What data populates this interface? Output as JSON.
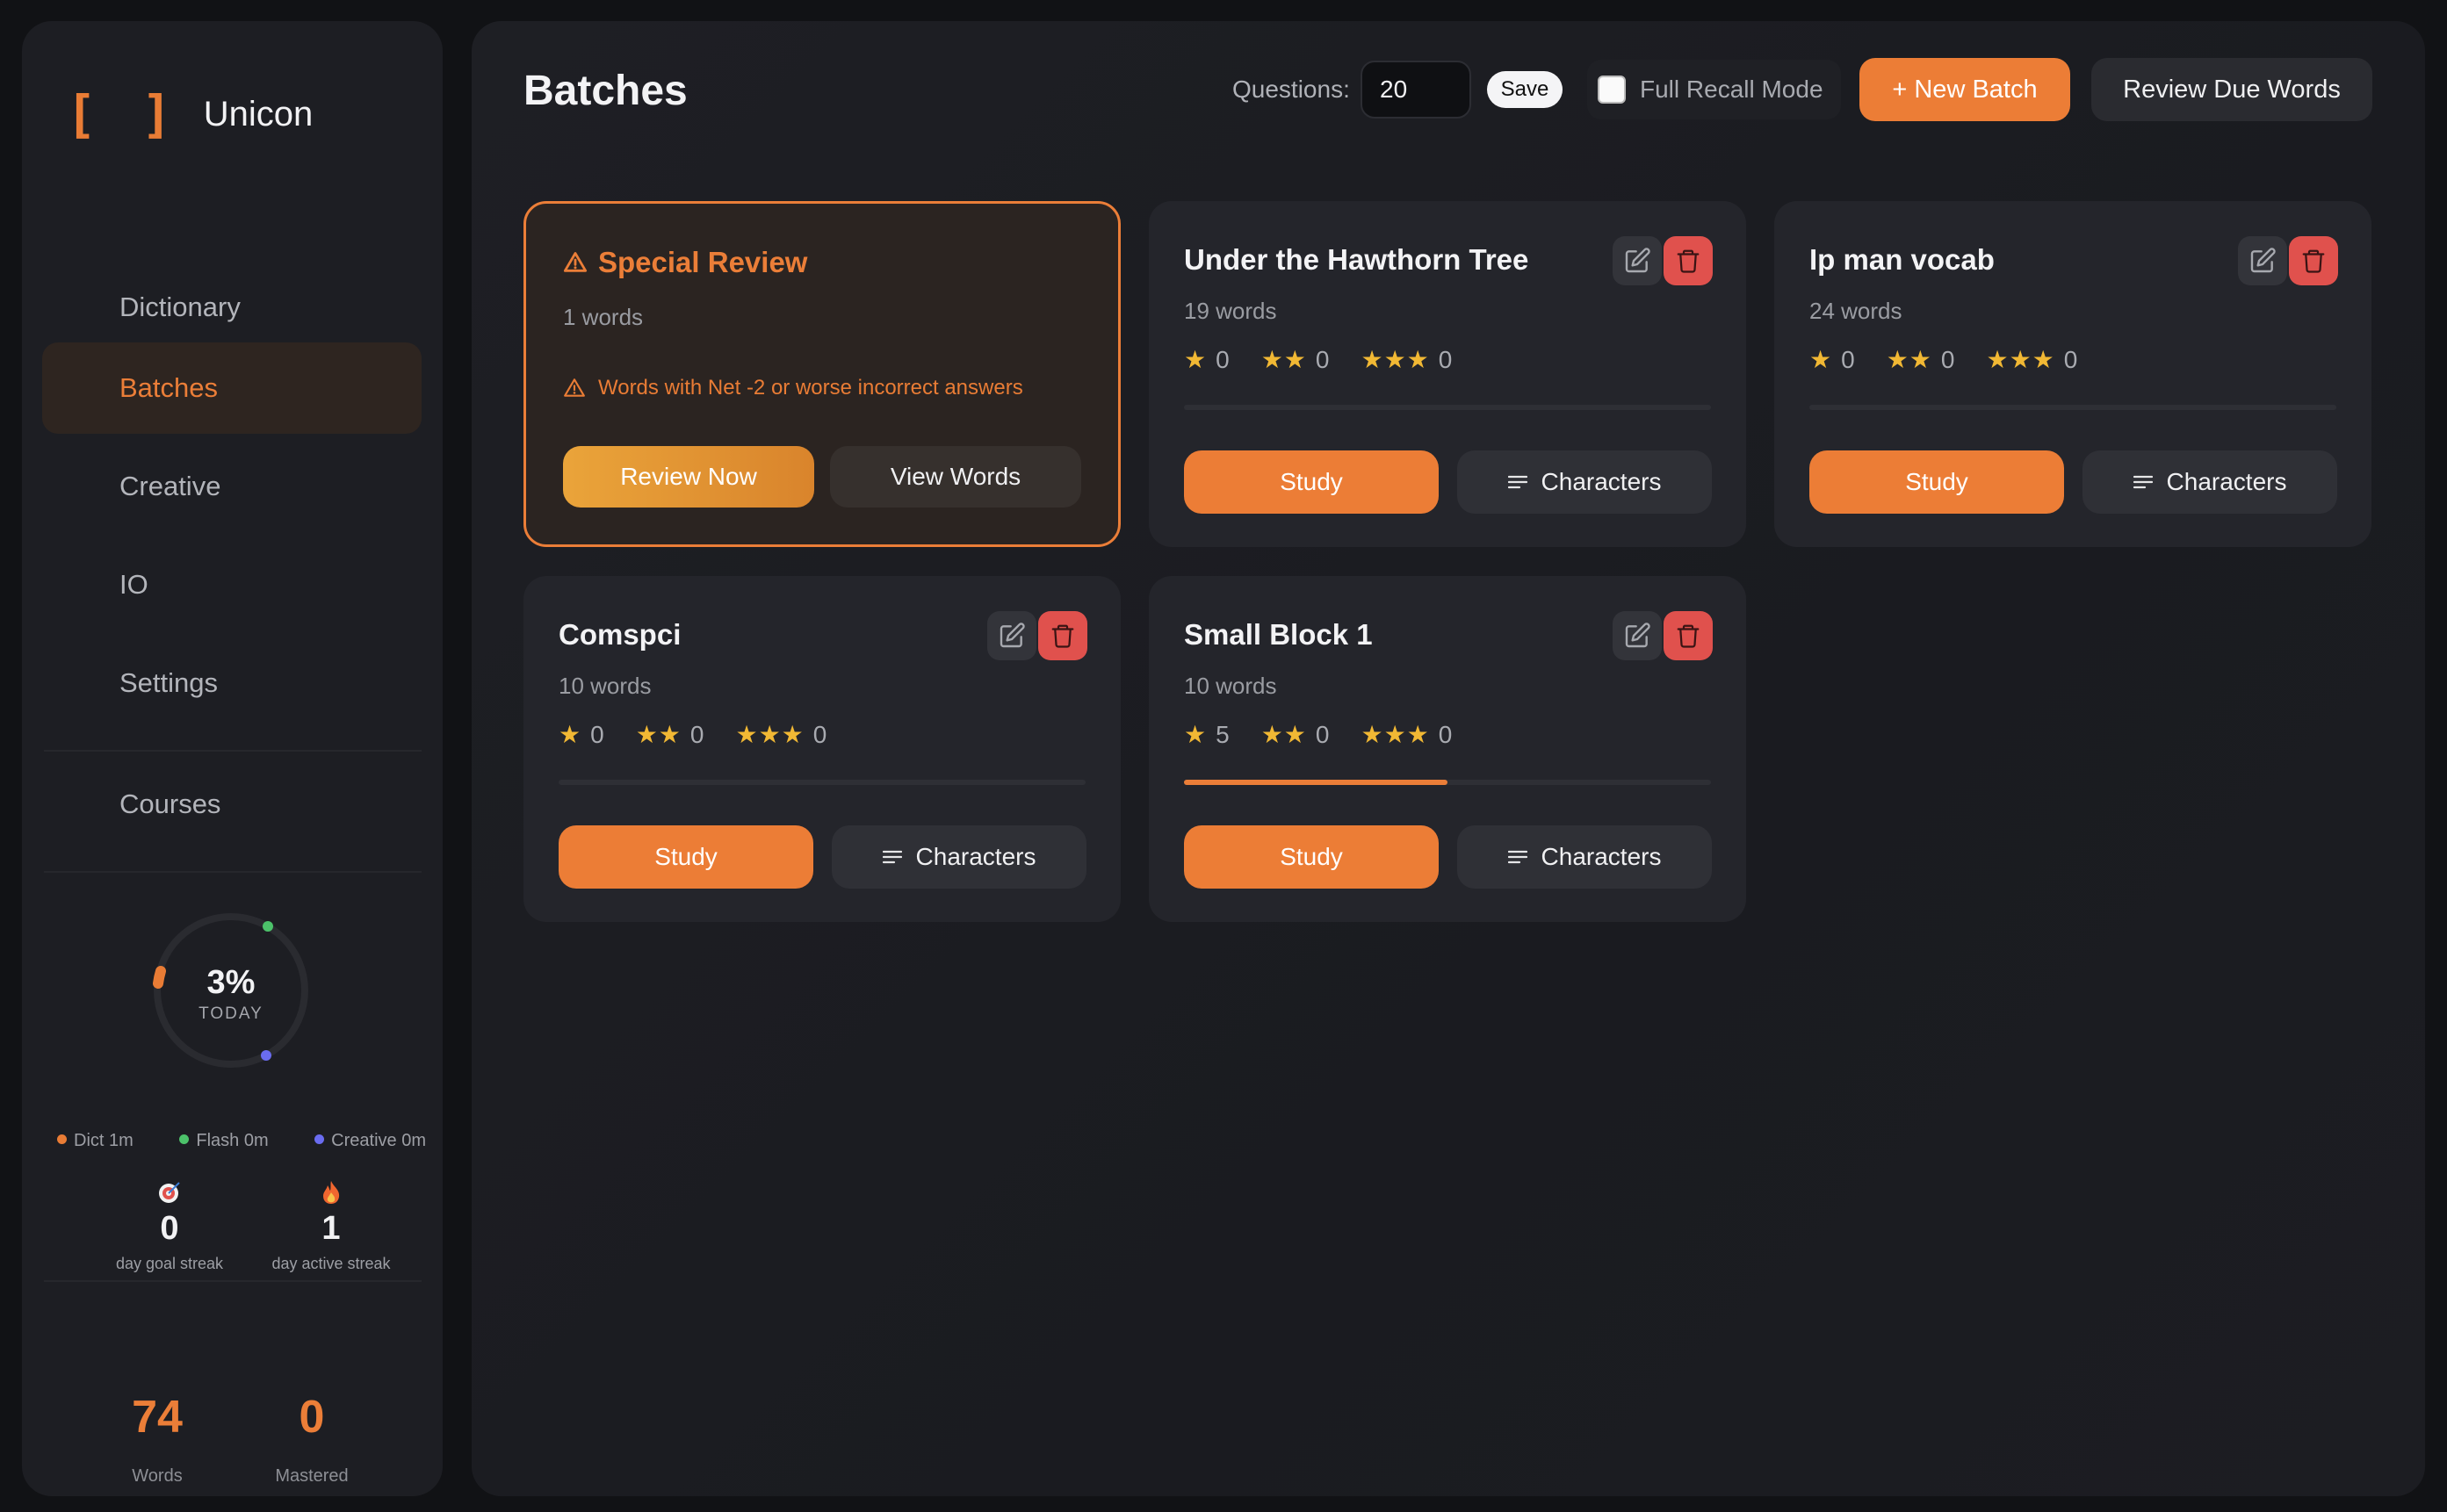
{
  "app": {
    "name": "Unicon",
    "logo": "[ ]"
  },
  "sidebar": {
    "items": [
      {
        "label": "Dictionary"
      },
      {
        "label": "Batches"
      },
      {
        "label": "Creative"
      },
      {
        "label": "IO"
      },
      {
        "label": "Settings"
      }
    ],
    "courses_label": "Courses",
    "today": {
      "percent_label": "3%",
      "percent": 0.03,
      "sub_label": "TODAY",
      "legend": [
        {
          "label": "Dict 1m",
          "color": "#e97c35"
        },
        {
          "label": "Flash 0m",
          "color": "#4cc26a"
        },
        {
          "label": "Creative 0m",
          "color": "#6a6cf0"
        }
      ]
    },
    "streaks": [
      {
        "icon": "target-icon",
        "value": "0",
        "label": "day goal streak"
      },
      {
        "icon": "fire-icon",
        "value": "1",
        "label": "day active streak"
      }
    ],
    "stats": [
      {
        "value": "74",
        "label": "Words"
      },
      {
        "value": "0",
        "label": "Mastered"
      }
    ]
  },
  "header": {
    "title": "Batches",
    "questions_label": "Questions:",
    "questions_value": "20",
    "save_label": "Save",
    "full_recall_label": "Full Recall Mode",
    "new_batch_label": "+ New Batch",
    "review_due_label": "Review Due Words"
  },
  "special_review": {
    "title": "Special Review",
    "count": "1 words",
    "note": "Words with Net -2 or worse incorrect answers",
    "review_label": "Review Now",
    "view_label": "View Words"
  },
  "batches": [
    {
      "title": "Under the Hawthorn Tree",
      "count": "19 words",
      "one_star": "0",
      "two_star": "0",
      "three_star": "0",
      "progress": 0,
      "study_label": "Study",
      "characters_label": "Characters"
    },
    {
      "title": "Ip man vocab",
      "count": "24 words",
      "one_star": "0",
      "two_star": "0",
      "three_star": "0",
      "progress": 0,
      "study_label": "Study",
      "characters_label": "Characters"
    },
    {
      "title": "Comspci",
      "count": "10 words",
      "one_star": "0",
      "two_star": "0",
      "three_star": "0",
      "progress": 0,
      "study_label": "Study",
      "characters_label": "Characters"
    },
    {
      "title": "Small Block 1",
      "count": "10 words",
      "one_star": "5",
      "two_star": "0",
      "three_star": "0",
      "progress": 0.5,
      "study_label": "Study",
      "characters_label": "Characters"
    }
  ],
  "colors": {
    "accent": "#eb7e38",
    "danger": "#e0514d",
    "star": "#f1b834"
  }
}
